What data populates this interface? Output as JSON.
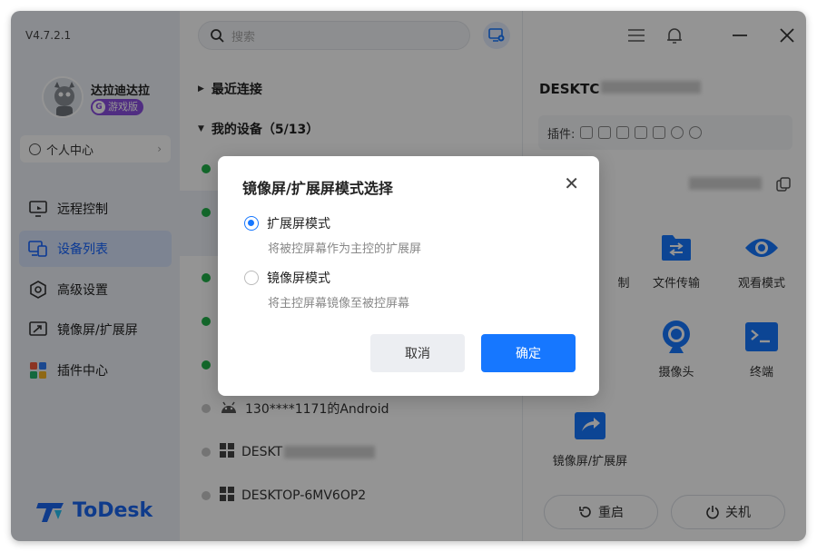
{
  "app": {
    "version": "V4.7.2.1",
    "brand": "ToDesk",
    "accent": "#1677ff"
  },
  "user": {
    "name": "达拉迪达拉",
    "badge": "游戏版",
    "badge_icon": "G",
    "personal_center": "个人中心"
  },
  "nav": [
    {
      "label": "远程控制",
      "icon": "remote-control-icon",
      "active": false
    },
    {
      "label": "设备列表",
      "icon": "device-list-icon",
      "active": true
    },
    {
      "label": "高级设置",
      "icon": "settings-icon",
      "active": false
    },
    {
      "label": "镜像屏/扩展屏",
      "icon": "mirror-screen-icon",
      "active": false
    },
    {
      "label": "插件中心",
      "icon": "plugin-icon",
      "active": false
    }
  ],
  "search": {
    "placeholder": "搜索"
  },
  "device_list": {
    "recent": "最近连接",
    "mine": "我的设备（5/13）",
    "rows": [
      {
        "status": "online",
        "name": ""
      },
      {
        "status": "online",
        "name": ""
      },
      {
        "status": "online",
        "name": ""
      },
      {
        "status": "online",
        "name": ""
      },
      {
        "status": "online",
        "name": ""
      },
      {
        "status": "offline",
        "name": "130****1171的Android"
      },
      {
        "status": "offline",
        "name": "DESKT"
      },
      {
        "status": "offline",
        "name": "DESKTOP-6MV6OP2"
      }
    ]
  },
  "detail": {
    "title": "DESKTC",
    "plugins_label": "插件:",
    "tiles": [
      {
        "label": "制",
        "icon": "remote-control-icon"
      },
      {
        "label": "文件传输",
        "icon": "file-transfer-icon"
      },
      {
        "label": "观看模式",
        "icon": "eye-icon"
      },
      {
        "label": "摄像头",
        "icon": "camera-icon"
      },
      {
        "label": "终端",
        "icon": "terminal-icon"
      },
      {
        "label": "镜像屏/扩展屏",
        "icon": "mirror-screen-icon"
      }
    ],
    "restart": "重启",
    "shutdown": "关机"
  },
  "dialog": {
    "title": "镜像屏/扩展屏模式选择",
    "options": [
      {
        "label": "扩展屏模式",
        "desc": "将被控屏幕作为主控的扩展屏",
        "selected": true
      },
      {
        "label": "镜像屏模式",
        "desc": "将主控屏幕镜像至被控屏幕",
        "selected": false
      }
    ],
    "cancel": "取消",
    "confirm": "确定"
  }
}
